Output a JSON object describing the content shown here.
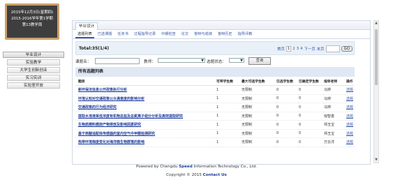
{
  "date_box": {
    "line1": "2015年12月3日(星期四)",
    "line2": "2015-2016学年第1学期",
    "line3": "第13教学周"
  },
  "sidebar": {
    "items": [
      {
        "label": "毕业设计",
        "active": true
      },
      {
        "label": "实验教学",
        "active": false
      },
      {
        "label": "大学生创新创业",
        "active": false
      },
      {
        "label": "实习实训",
        "active": false
      },
      {
        "label": "实验室开放",
        "active": false
      }
    ]
  },
  "top_tab": "毕业设计",
  "sub_tabs": [
    "选题列表",
    "已选课题",
    "任务书",
    "过程指导记录",
    "中期检查",
    "论文",
    "答辩与成绩",
    "答辩历史",
    "指导评教"
  ],
  "total": "Total:35(1/4)",
  "pager": {
    "first": "首页",
    "pages": [
      "1",
      "2",
      "3",
      "4"
    ],
    "next": "下一页",
    "last": "末页",
    "go": "GO"
  },
  "filter": {
    "title_label": "课题名：",
    "teacher_label": "教师：",
    "status_label": "选题状态：",
    "query_button": "查询"
  },
  "section_title": "所有选题列表",
  "table": {
    "headers": [
      "题目",
      "可带学生数",
      "最大可选学生数",
      "已选学生数",
      "已确定学生数",
      "指导老师",
      "操作"
    ],
    "rows": [
      [
        "新环保法信息公开政策执行分析",
        "1",
        "无限制",
        "0",
        "0",
        "马婷",
        "选题"
      ],
      [
        "环境认知对交通政策公众满意度的影响分析",
        "1",
        "无限制",
        "0",
        "0",
        "马婷",
        "选题"
      ],
      [
        "交通政策的行为经济研究",
        "1",
        "无限制",
        "0",
        "0",
        "马婷",
        "选题"
      ],
      [
        "提取水溶液某低浓度有机物总盐及总氮离子组分分析及高效提取研究",
        "1",
        "无限制",
        "0",
        "0",
        "倪智勇",
        "选题"
      ],
      [
        "生物质燃料燃烧产物排放及影响因素研究",
        "1",
        "无限制",
        "0",
        "0",
        "师玉宝",
        "选题"
      ],
      [
        "基于核酸适配体传感器的室内空气中甲醛检测研究",
        "1",
        "无限制",
        "0",
        "0",
        "师玉宝",
        "选题"
      ],
      [
        "热带环境梯度变化对海洋微生物群落的影响",
        "1",
        "无限制",
        "0",
        "0",
        "万云洋",
        "选题"
      ]
    ]
  },
  "footer": {
    "powered_prefix": "Powered by Chengdu ",
    "powered_brand": "Speed",
    "powered_suffix": " Information Technology Co., Ltd.",
    "copyright_prefix": "Copyright © 2015 ",
    "copyright_link": "Contact Us"
  }
}
